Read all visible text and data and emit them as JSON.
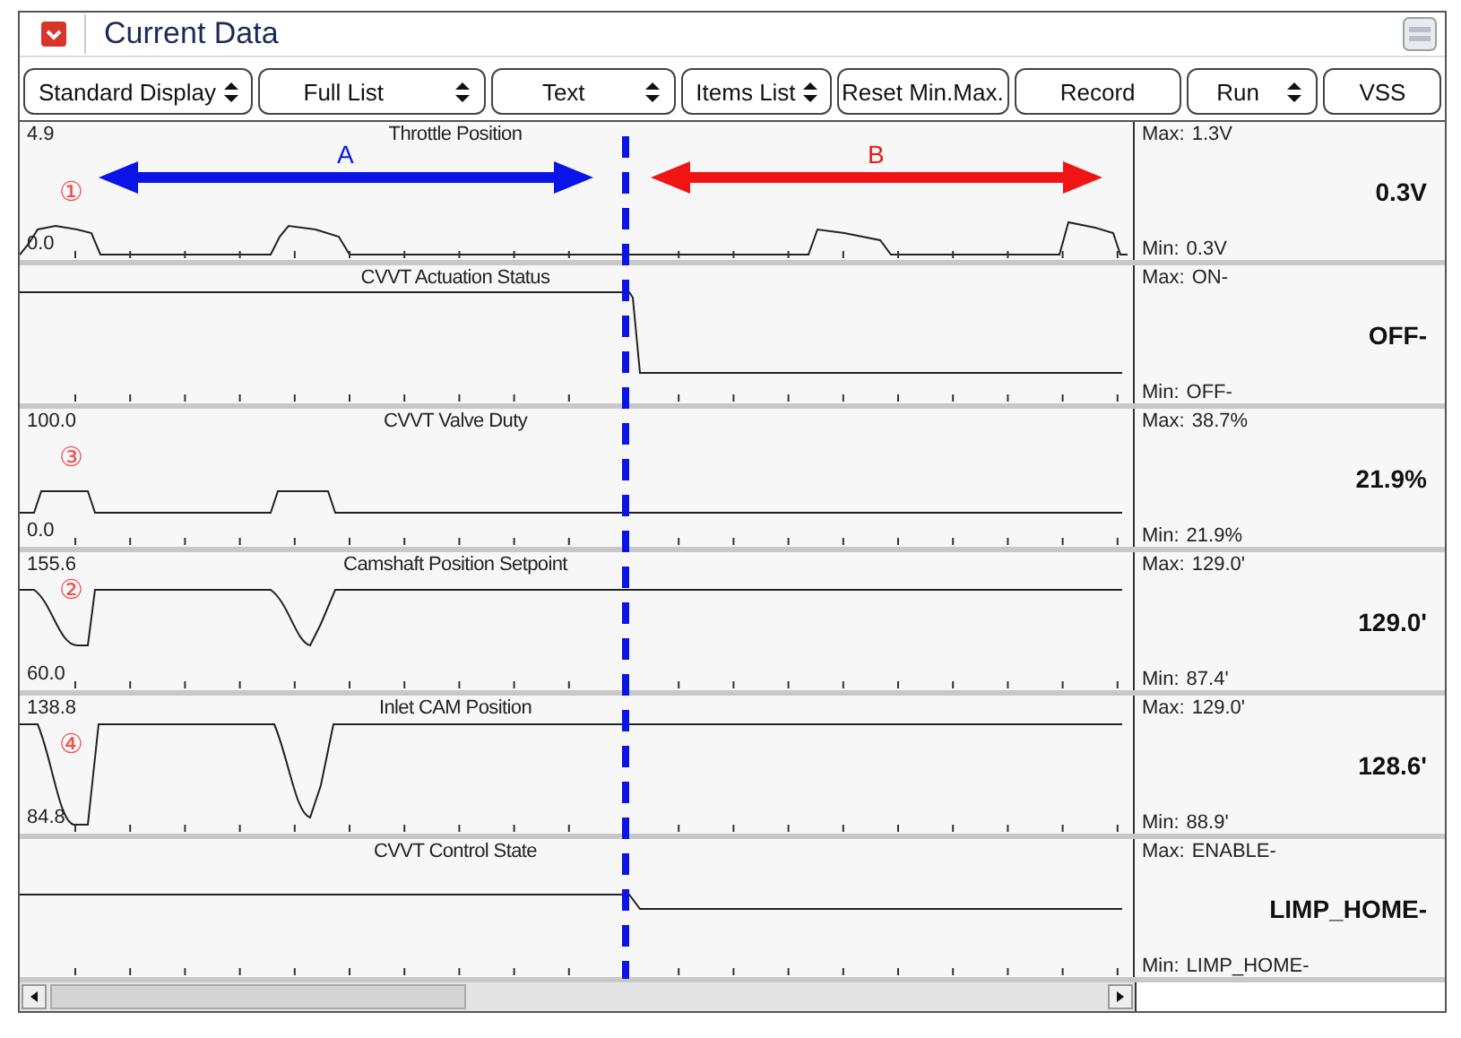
{
  "window": {
    "title": "Current Data"
  },
  "toolbar": [
    {
      "label": "Standard Display",
      "dropdown": true
    },
    {
      "label": "Full List",
      "dropdown": true
    },
    {
      "label": "Text",
      "dropdown": true
    },
    {
      "label": "Items List",
      "dropdown": true
    },
    {
      "label": "Reset Min.Max.",
      "dropdown": false
    },
    {
      "label": "Record",
      "dropdown": false
    },
    {
      "label": "Run",
      "dropdown": true
    },
    {
      "label": "VSS",
      "dropdown": false
    }
  ],
  "panels": [
    {
      "title": "Throttle Position",
      "scale_max": "4.9",
      "scale_min": "0.0",
      "marker": "①",
      "max_label": "Max:",
      "max": "1.3V",
      "value": "0.3V",
      "min_label": "Min:",
      "min": "0.3V"
    },
    {
      "title": "CVVT Actuation Status",
      "max_label": "Max:",
      "max": "ON-",
      "value": "OFF-",
      "min_label": "Min:",
      "min": "OFF-"
    },
    {
      "title": "CVVT Valve Duty",
      "scale_max": "100.0",
      "scale_min": "0.0",
      "marker": "③",
      "max_label": "Max:",
      "max": "38.7%",
      "value": "21.9%",
      "min_label": "Min:",
      "min": "21.9%"
    },
    {
      "title": "Camshaft Position Setpoint",
      "scale_max": "155.6",
      "scale_min": "60.0",
      "marker": "②",
      "max_label": "Max:",
      "max": "129.0'",
      "value": "129.0'",
      "min_label": "Min:",
      "min": "87.4'"
    },
    {
      "title": "Inlet CAM Position",
      "scale_max": "138.8",
      "scale_min": "84.8",
      "marker": "④",
      "max_label": "Max:",
      "max": "129.0'",
      "value": "128.6'",
      "min_label": "Min:",
      "min": "88.9'"
    },
    {
      "title": "CVVT Control State",
      "max_label": "Max:",
      "max": "ENABLE-",
      "value": "LIMP_HOME-",
      "min_label": "Min:",
      "min": "LIMP_HOME-"
    }
  ],
  "arrows": [
    {
      "label": "A",
      "color": "#0a14e6"
    },
    {
      "label": "B",
      "color": "#f01414"
    }
  ]
}
